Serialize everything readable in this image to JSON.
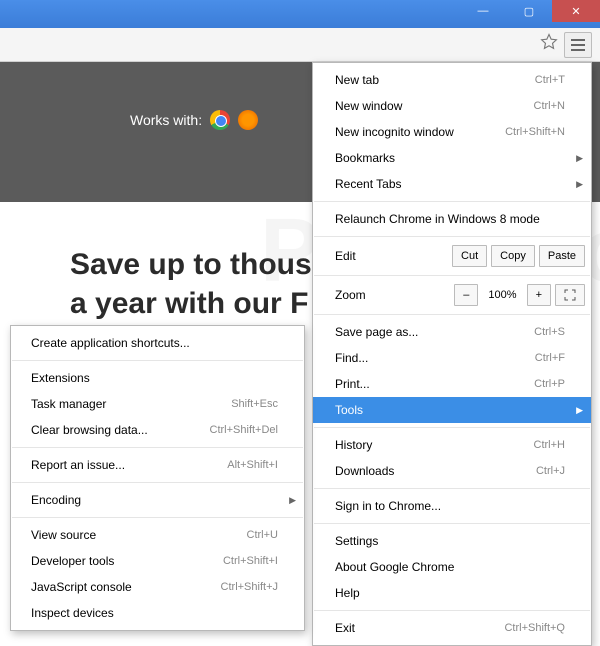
{
  "titlebar": {
    "min": "—",
    "max": "▢",
    "close": "✕"
  },
  "page": {
    "works_with": "Works with:",
    "headline_l1": "Save up to thous",
    "headline_l2": "a year with our F",
    "watermark": "PCrisk.com"
  },
  "menu": {
    "new_tab": "New tab",
    "new_tab_sc": "Ctrl+T",
    "new_window": "New window",
    "new_window_sc": "Ctrl+N",
    "incognito": "New incognito window",
    "incognito_sc": "Ctrl+Shift+N",
    "bookmarks": "Bookmarks",
    "recent_tabs": "Recent Tabs",
    "relaunch": "Relaunch Chrome in Windows 8 mode",
    "edit": "Edit",
    "cut": "Cut",
    "copy": "Copy",
    "paste": "Paste",
    "zoom": "Zoom",
    "zoom_minus": "–",
    "zoom_val": "100%",
    "zoom_plus": "+",
    "save_as": "Save page as...",
    "save_as_sc": "Ctrl+S",
    "find": "Find...",
    "find_sc": "Ctrl+F",
    "print": "Print...",
    "print_sc": "Ctrl+P",
    "tools": "Tools",
    "history": "History",
    "history_sc": "Ctrl+H",
    "downloads": "Downloads",
    "downloads_sc": "Ctrl+J",
    "signin": "Sign in to Chrome...",
    "settings": "Settings",
    "about": "About Google Chrome",
    "help": "Help",
    "exit": "Exit",
    "exit_sc": "Ctrl+Shift+Q"
  },
  "submenu": {
    "create_shortcuts": "Create application shortcuts...",
    "extensions": "Extensions",
    "task_mgr": "Task manager",
    "task_mgr_sc": "Shift+Esc",
    "clear_data": "Clear browsing data...",
    "clear_data_sc": "Ctrl+Shift+Del",
    "report": "Report an issue...",
    "report_sc": "Alt+Shift+I",
    "encoding": "Encoding",
    "view_src": "View source",
    "view_src_sc": "Ctrl+U",
    "dev_tools": "Developer tools",
    "dev_tools_sc": "Ctrl+Shift+I",
    "js_console": "JavaScript console",
    "js_console_sc": "Ctrl+Shift+J",
    "inspect": "Inspect devices"
  }
}
